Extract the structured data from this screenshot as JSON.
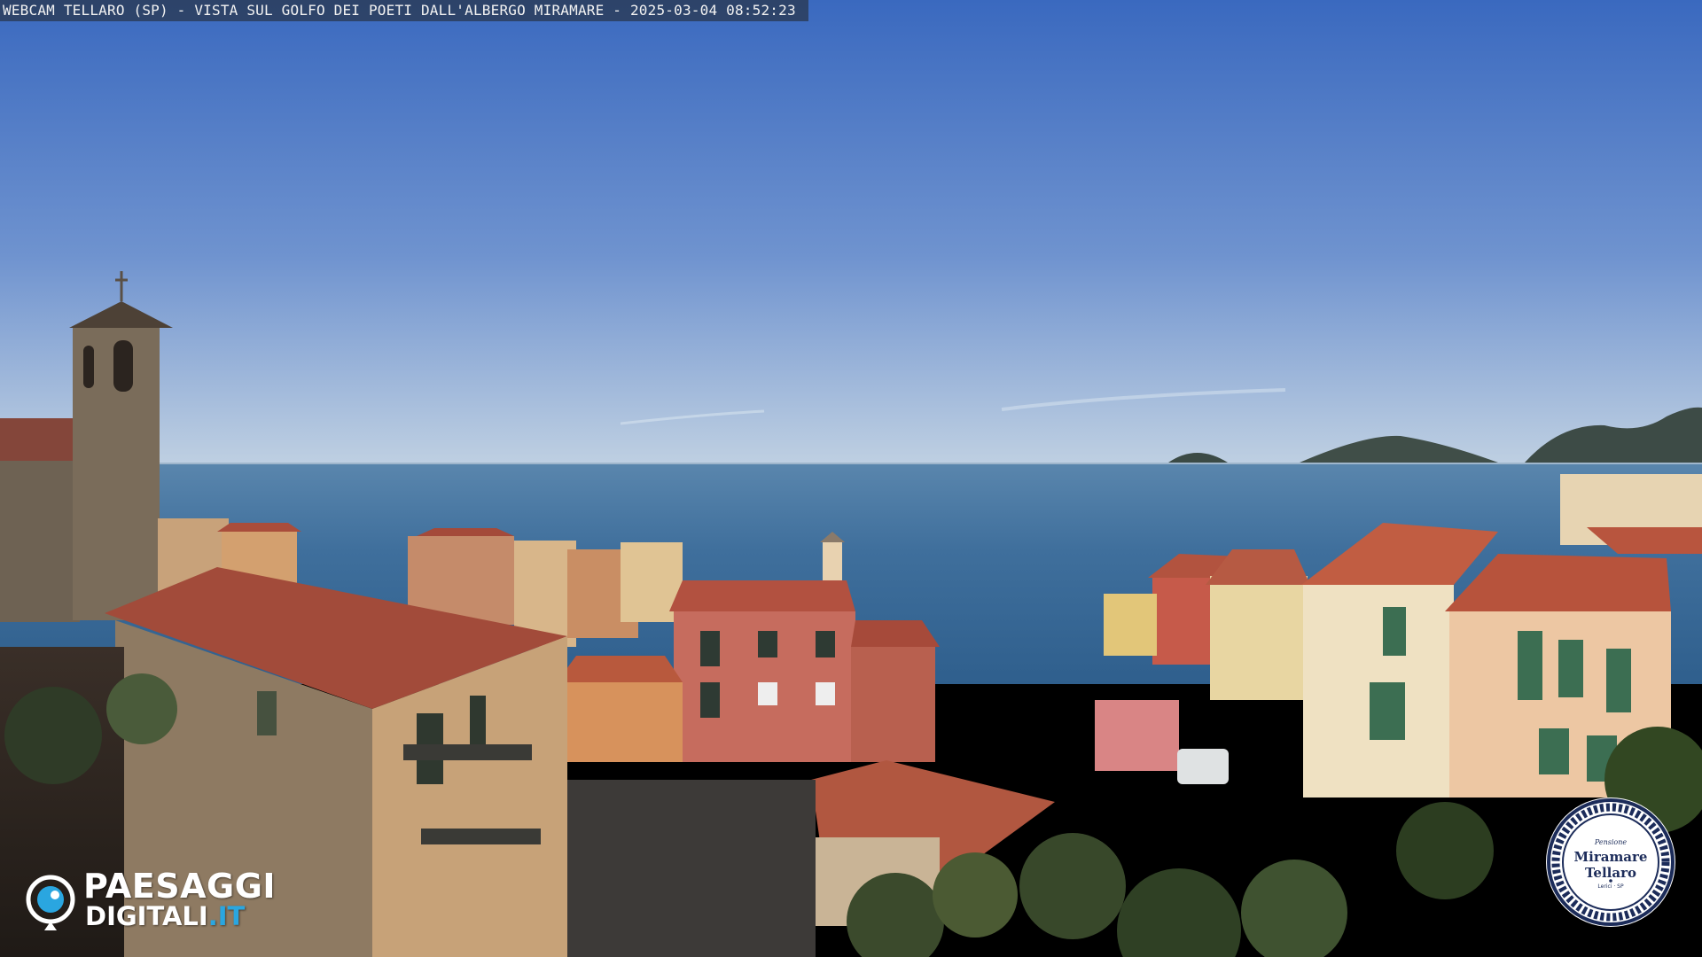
{
  "caption": {
    "text": "WEBCAM TELLARO (SP) - VISTA SUL GOLFO DEI POETI DALL'ALBERGO MIRAMARE - 2025-03-04 08:52:23"
  },
  "brand_logo": {
    "line1": "PAESAGGI",
    "line2_main": "DIGITALI",
    "line2_tld": ".IT",
    "icon": "eye-icon",
    "accent_color": "#2aa6e0"
  },
  "hotel_seal": {
    "small_text": "Pensione",
    "name_line1": "Miramare",
    "name_line2": "Tellaro",
    "tiny_text": "Lerici · SP",
    "ring_color": "#1c2c5a"
  },
  "colors": {
    "sky_top": "#3f6fc2",
    "sky_horizon": "#b9cbe0",
    "sea": "#3d6d9a",
    "roof": "#b4553f"
  }
}
